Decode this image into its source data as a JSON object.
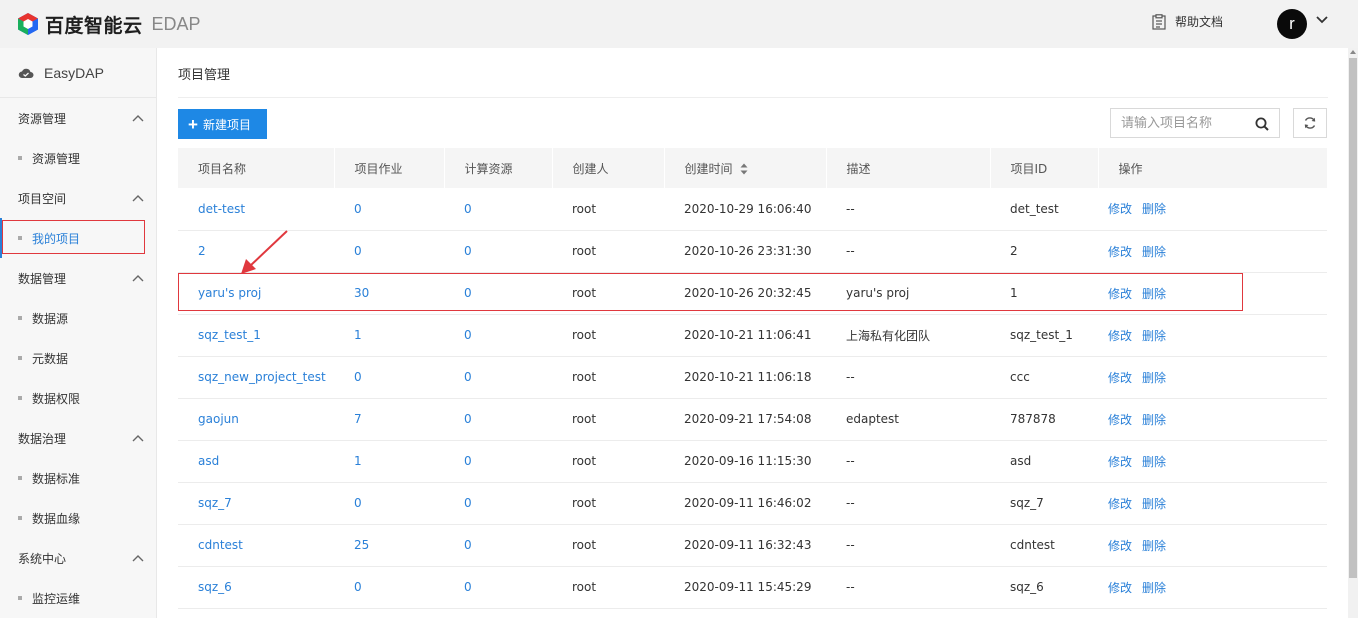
{
  "header": {
    "brand": "百度智能云",
    "product": "EDAP",
    "help": "帮助文档",
    "avatar_letter": "r"
  },
  "sidebar": {
    "app_name": "EasyDAP",
    "groups": [
      {
        "label": "资源管理",
        "items": [
          "资源管理"
        ]
      },
      {
        "label": "项目空间",
        "items": [
          "我的项目"
        ]
      },
      {
        "label": "数据管理",
        "items": [
          "数据源",
          "元数据",
          "数据权限"
        ]
      },
      {
        "label": "数据治理",
        "items": [
          "数据标准",
          "数据血缘"
        ]
      },
      {
        "label": "系统中心",
        "items": [
          "监控运维"
        ]
      }
    ],
    "active_item": "我的项目"
  },
  "main": {
    "title": "项目管理",
    "new_button": "新建项目",
    "search_placeholder": "请输入项目名称",
    "columns": [
      "项目名称",
      "项目作业",
      "计算资源",
      "创建人",
      "创建时间",
      "描述",
      "项目ID",
      "操作"
    ],
    "actions": {
      "edit": "修改",
      "delete": "删除"
    },
    "rows": [
      {
        "name": "det-test",
        "jobs": "0",
        "compute": "0",
        "creator": "root",
        "created": "2020-10-29 16:06:40",
        "desc": "--",
        "id": "det_test"
      },
      {
        "name": "2",
        "jobs": "0",
        "compute": "0",
        "creator": "root",
        "created": "2020-10-26 23:31:30",
        "desc": "--",
        "id": "2"
      },
      {
        "name": "yaru's proj",
        "jobs": "30",
        "compute": "0",
        "creator": "root",
        "created": "2020-10-26 20:32:45",
        "desc": "yaru's proj",
        "id": "1"
      },
      {
        "name": "sqz_test_1",
        "jobs": "1",
        "compute": "0",
        "creator": "root",
        "created": "2020-10-21 11:06:41",
        "desc": "上海私有化团队",
        "id": "sqz_test_1"
      },
      {
        "name": "sqz_new_project_test",
        "jobs": "0",
        "compute": "0",
        "creator": "root",
        "created": "2020-10-21 11:06:18",
        "desc": "--",
        "id": "ccc"
      },
      {
        "name": "gaojun",
        "jobs": "7",
        "compute": "0",
        "creator": "root",
        "created": "2020-09-21 17:54:08",
        "desc": "edaptest",
        "id": "787878"
      },
      {
        "name": "asd",
        "jobs": "1",
        "compute": "0",
        "creator": "root",
        "created": "2020-09-16 11:15:30",
        "desc": "--",
        "id": "asd"
      },
      {
        "name": "sqz_7",
        "jobs": "0",
        "compute": "0",
        "creator": "root",
        "created": "2020-09-11 16:46:02",
        "desc": "--",
        "id": "sqz_7"
      },
      {
        "name": "cdntest",
        "jobs": "25",
        "compute": "0",
        "creator": "root",
        "created": "2020-09-11 16:32:43",
        "desc": "--",
        "id": "cdntest"
      },
      {
        "name": "sqz_6",
        "jobs": "0",
        "compute": "0",
        "creator": "root",
        "created": "2020-09-11 15:45:29",
        "desc": "--",
        "id": "sqz_6"
      }
    ]
  },
  "colors": {
    "accent": "#1e88e5",
    "link": "#2a80d8",
    "highlight": "#e0383e"
  }
}
